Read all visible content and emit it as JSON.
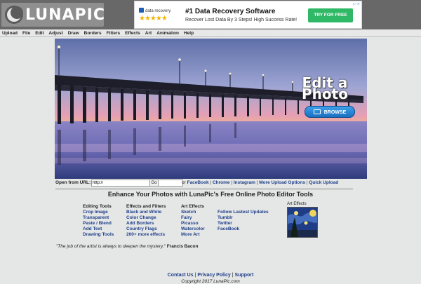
{
  "logo": {
    "text": "LUNAPIC"
  },
  "ad": {
    "brand": "data recovery",
    "stars": "★★★★★",
    "headline": "#1 Data Recovery Software",
    "subline": "Recover Lost Data By 3 Steps!  High Success Rate!",
    "cta": "TRY FOR FREE",
    "corner": "▷ ✕"
  },
  "menu": [
    "Upload",
    "File",
    "Edit",
    "Adjust",
    "Draw",
    "Borders",
    "Filters",
    "Effects",
    "Art",
    "Animation",
    "Help"
  ],
  "hero": {
    "title_line1": "Edit a",
    "title_line2": "Photo",
    "browse_label": "BROWSE"
  },
  "url_row": {
    "label": "Open from URL:",
    "input_value": "http://",
    "go_label": "Go",
    "or_text": "or",
    "links": [
      "FaceBook",
      "Chrome",
      "Instagram",
      "More Upload Options",
      "Quick Upload"
    ],
    "separator": " | "
  },
  "tagline": "Enhance Your Photos with LunaPic's Free Online Photo Editor Tools",
  "columns": {
    "editing": {
      "heading": "Editing Tools",
      "links": [
        "Crop Image",
        "Transparent",
        "Paste / Blend",
        "Add Text",
        "Drawing Tools"
      ]
    },
    "effects": {
      "heading": "Effects and Filters",
      "links": [
        "Black and White",
        "Color Change",
        "Add Borders",
        "Country Flags",
        "200+ more effects"
      ]
    },
    "art": {
      "heading": "Art Effects",
      "links": [
        "Sketch",
        "Fairy",
        "Picasso",
        "Watercolor",
        "More Art"
      ]
    },
    "social": {
      "links": [
        "Follow Lastest Updates",
        "Tumblr",
        "Twitter",
        "FaceBook"
      ]
    }
  },
  "art_effects_label": "Art Effects",
  "quote": {
    "text": "\"The job of the artist is always to deepen the mystery.\"",
    "author": "Francis Bacon"
  },
  "footer": {
    "links": [
      "Contact Us",
      "Privacy Policy",
      "Support"
    ],
    "separator": " | ",
    "copyright": "Copyright 2017 LunaPic.com"
  },
  "colors": {
    "header_bg": "#686868",
    "link": "#1d3f8a",
    "browse_blue": "#1a6fc0",
    "cta_green": "#2fb865"
  }
}
